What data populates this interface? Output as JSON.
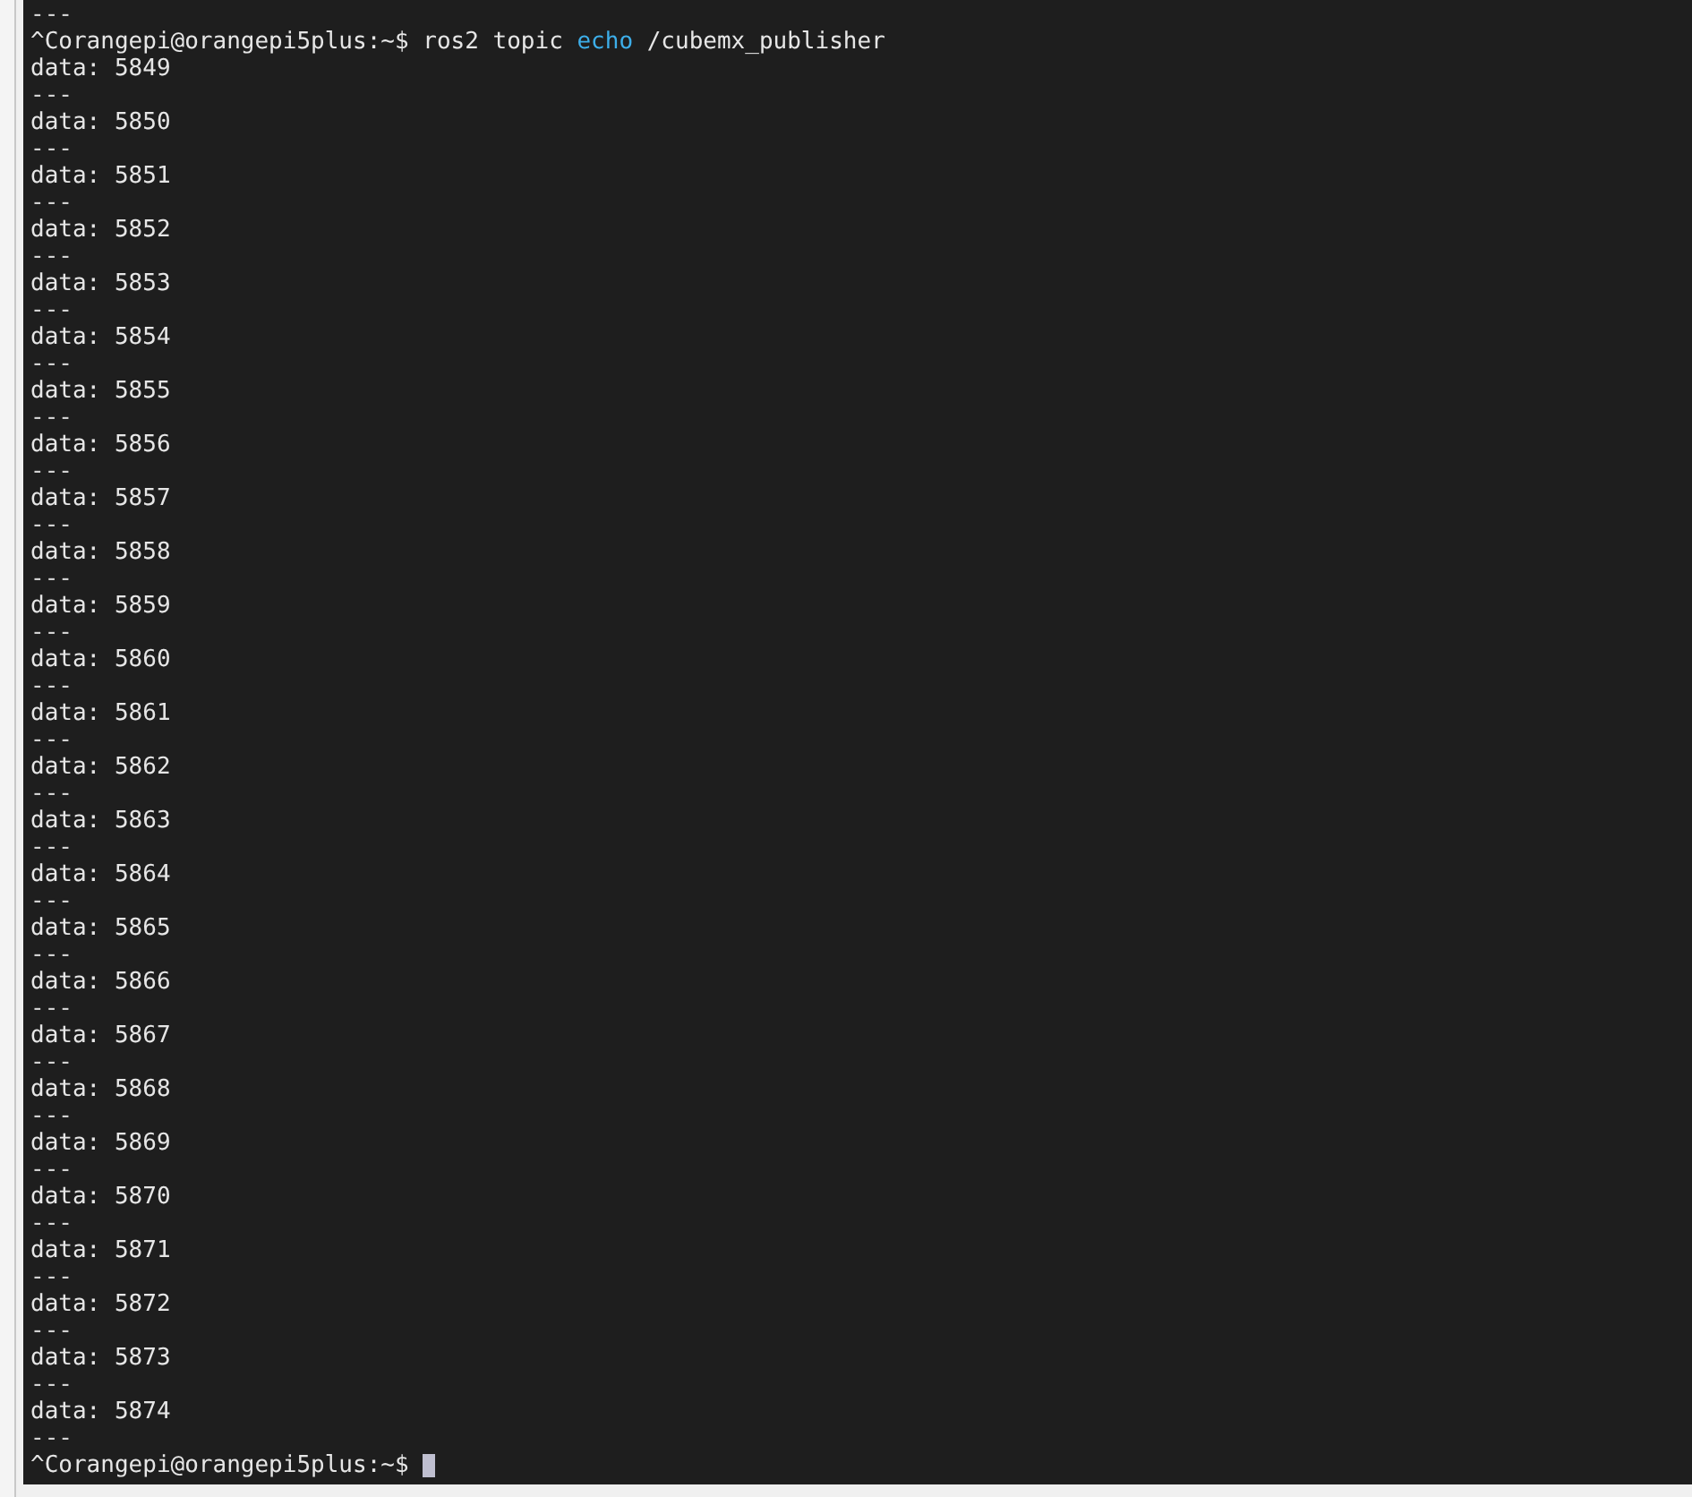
{
  "terminal": {
    "lines": [
      {
        "kind": "separator",
        "text": "---"
      },
      {
        "kind": "prompt",
        "prompt": "^Corangepi@orangepi5plus:~$",
        "command": [
          {
            "text": "ros2 topic",
            "kind": "plain"
          },
          {
            "text": "echo",
            "kind": "keyword"
          },
          {
            "text": "/cubemx_publisher",
            "kind": "plain"
          }
        ],
        "cursor": false
      },
      {
        "kind": "output",
        "text": "data: 5849"
      },
      {
        "kind": "separator",
        "text": "---"
      },
      {
        "kind": "output",
        "text": "data: 5850"
      },
      {
        "kind": "separator",
        "text": "---"
      },
      {
        "kind": "output",
        "text": "data: 5851"
      },
      {
        "kind": "separator",
        "text": "---"
      },
      {
        "kind": "output",
        "text": "data: 5852"
      },
      {
        "kind": "separator",
        "text": "---"
      },
      {
        "kind": "output",
        "text": "data: 5853"
      },
      {
        "kind": "separator",
        "text": "---"
      },
      {
        "kind": "output",
        "text": "data: 5854"
      },
      {
        "kind": "separator",
        "text": "---"
      },
      {
        "kind": "output",
        "text": "data: 5855"
      },
      {
        "kind": "separator",
        "text": "---"
      },
      {
        "kind": "output",
        "text": "data: 5856"
      },
      {
        "kind": "separator",
        "text": "---"
      },
      {
        "kind": "output",
        "text": "data: 5857"
      },
      {
        "kind": "separator",
        "text": "---"
      },
      {
        "kind": "output",
        "text": "data: 5858"
      },
      {
        "kind": "separator",
        "text": "---"
      },
      {
        "kind": "output",
        "text": "data: 5859"
      },
      {
        "kind": "separator",
        "text": "---"
      },
      {
        "kind": "output",
        "text": "data: 5860"
      },
      {
        "kind": "separator",
        "text": "---"
      },
      {
        "kind": "output",
        "text": "data: 5861"
      },
      {
        "kind": "separator",
        "text": "---"
      },
      {
        "kind": "output",
        "text": "data: 5862"
      },
      {
        "kind": "separator",
        "text": "---"
      },
      {
        "kind": "output",
        "text": "data: 5863"
      },
      {
        "kind": "separator",
        "text": "---"
      },
      {
        "kind": "output",
        "text": "data: 5864"
      },
      {
        "kind": "separator",
        "text": "---"
      },
      {
        "kind": "output",
        "text": "data: 5865"
      },
      {
        "kind": "separator",
        "text": "---"
      },
      {
        "kind": "output",
        "text": "data: 5866"
      },
      {
        "kind": "separator",
        "text": "---"
      },
      {
        "kind": "output",
        "text": "data: 5867"
      },
      {
        "kind": "separator",
        "text": "---"
      },
      {
        "kind": "output",
        "text": "data: 5868"
      },
      {
        "kind": "separator",
        "text": "---"
      },
      {
        "kind": "output",
        "text": "data: 5869"
      },
      {
        "kind": "separator",
        "text": "---"
      },
      {
        "kind": "output",
        "text": "data: 5870"
      },
      {
        "kind": "separator",
        "text": "---"
      },
      {
        "kind": "output",
        "text": "data: 5871"
      },
      {
        "kind": "separator",
        "text": "---"
      },
      {
        "kind": "output",
        "text": "data: 5872"
      },
      {
        "kind": "separator",
        "text": "---"
      },
      {
        "kind": "output",
        "text": "data: 5873"
      },
      {
        "kind": "separator",
        "text": "---"
      },
      {
        "kind": "output",
        "text": "data: 5874"
      },
      {
        "kind": "separator",
        "text": "---"
      },
      {
        "kind": "prompt",
        "prompt": "^Corangepi@orangepi5plus:~$",
        "cursor": true
      }
    ]
  }
}
